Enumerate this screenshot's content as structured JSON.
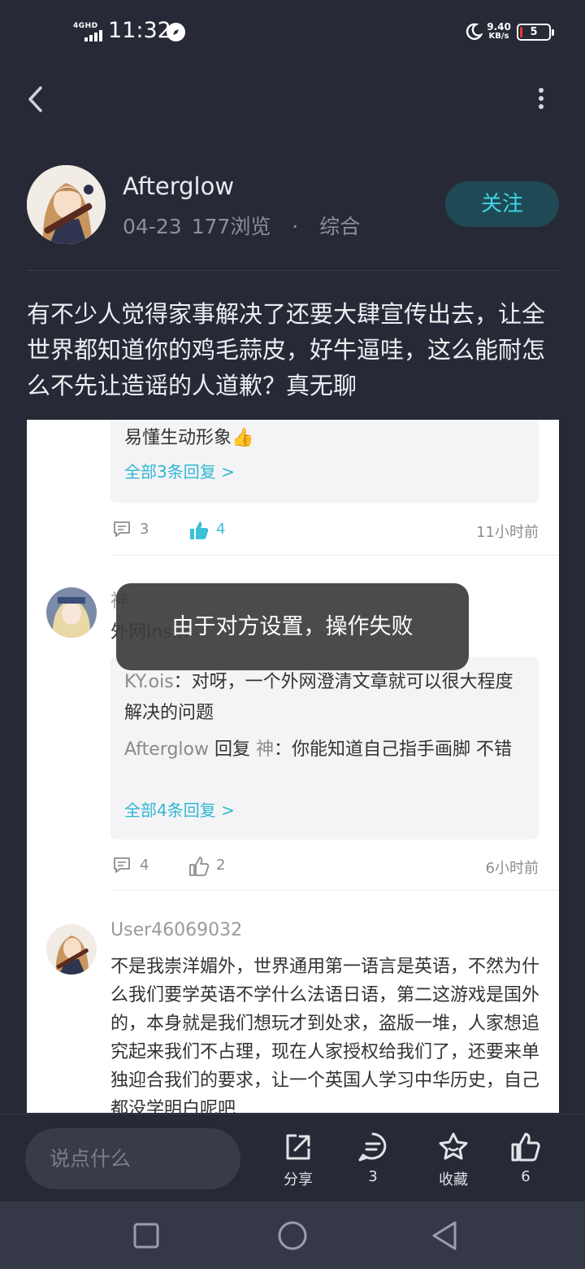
{
  "status_bar": {
    "network": "4GHD",
    "time": "11:32",
    "speed_value": "9.40",
    "speed_unit": "KB/s",
    "battery": "5"
  },
  "post": {
    "author": "Afterglow",
    "date": "04-23",
    "views": "177浏览",
    "separator": "·",
    "category": "综合",
    "follow_label": "关注",
    "body": "有不少人觉得家事解决了还要大肆宣传出去，让全世界都知道你的鸡毛蒜皮，好牛逼哇，这么能耐怎么不先让造谣的人道歉？真无聊"
  },
  "screenshot": {
    "first_reply_tail": "易懂生动形象👍",
    "first_more": "全部3条回复 >",
    "first_comment_count": "3",
    "first_like_count": "4",
    "first_time": "11小时前",
    "second_name": "神",
    "second_text": "外网ins...",
    "replies": [
      {
        "name": "KY.ois",
        "sep": "：",
        "text": "对呀，一个外网澄清文章就可以很大程度解决的问题"
      },
      {
        "name": "Afterglow",
        "mid": " 回复 ",
        "target": "神",
        "sep": "：",
        "text": "你能知道自己指手画脚 不错"
      }
    ],
    "second_more": "全部4条回复 >",
    "second_comment_count": "4",
    "second_like_count": "2",
    "second_time": "6小时前",
    "third_name": "User46069032",
    "third_text": "不是我崇洋媚外，世界通用第一语言是英语，不然为什么我们要学英语不学什么法语日语，第二这游戏是国外的，本身就是我们想玩才到处求，盗版一堆，人家想追究起来我们不占理，现在人家授权给我们了，还要来单独迎合我们的要求，让一个英国人学习中华历史，自己都没学明白呢吧"
  },
  "toast": "由于对方设置，操作失败",
  "bottom_bar": {
    "input_placeholder": "说点什么",
    "share_label": "分享",
    "comment_count": "3",
    "favorite_label": "收藏",
    "like_count": "6"
  },
  "colors": {
    "background": "#272a36",
    "accent": "#3fd5e8",
    "follow_bg": "#1f4a55"
  }
}
